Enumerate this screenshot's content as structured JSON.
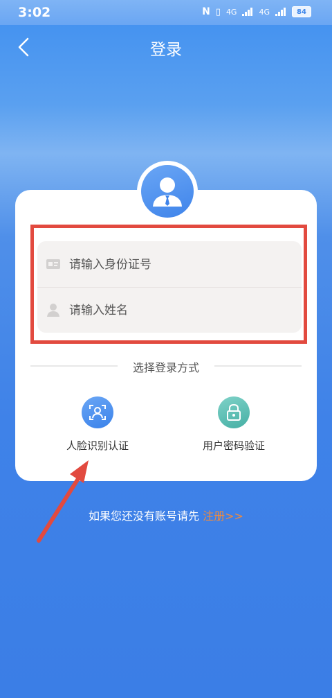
{
  "status": {
    "time": "3:02",
    "signal1": "4G",
    "signal2": "4G",
    "battery": "84"
  },
  "header": {
    "title": "登录"
  },
  "form": {
    "id_placeholder": "请输入身份证号",
    "name_placeholder": "请输入姓名"
  },
  "login": {
    "divider_label": "选择登录方式",
    "methods": [
      {
        "label": "人脸识别认证",
        "icon": "face-scan-icon"
      },
      {
        "label": "用户密码验证",
        "icon": "lock-icon"
      }
    ]
  },
  "register": {
    "prompt": "如果您还没有账号请先",
    "link": "注册>>"
  },
  "colors": {
    "primary": "#3f84ea",
    "accent": "#f08a3d",
    "highlight": "#e24a3f",
    "teal": "#45afa4"
  }
}
